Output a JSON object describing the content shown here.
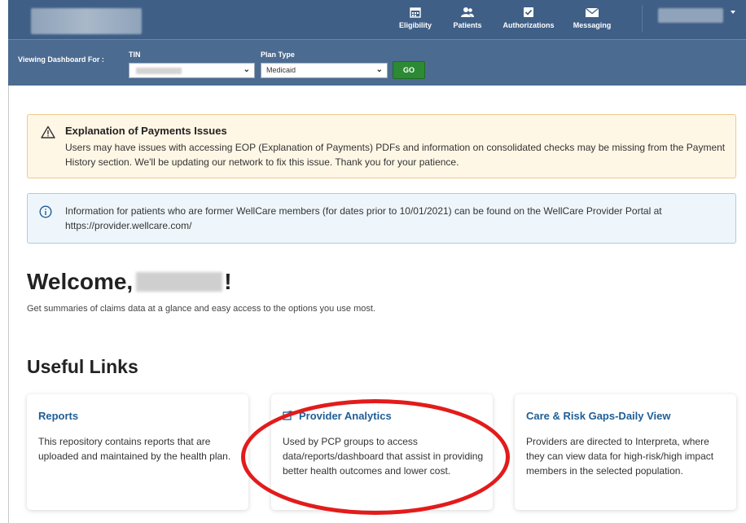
{
  "nav": {
    "items": [
      {
        "label": "Eligibility",
        "icon": "calendar-icon"
      },
      {
        "label": "Patients",
        "icon": "patients-icon"
      },
      {
        "label": "Authorizations",
        "icon": "authorizations-icon"
      },
      {
        "label": "Messaging",
        "icon": "envelope-icon"
      }
    ],
    "background": "#3f5f86"
  },
  "filter": {
    "viewing_label": "Viewing Dashboard For :",
    "tin_label": "TIN",
    "tin_value": "",
    "plan_label": "Plan Type",
    "plan_value": "Medicaid",
    "go_label": "GO",
    "go_color": "#2c8a34"
  },
  "alerts": {
    "warning": {
      "title": "Explanation of Payments Issues",
      "body": "Users may have issues with accessing EOP (Explanation of Payments) PDFs and information on consolidated checks may be missing from the Payment History section. We'll be updating our network to fix this issue.  Thank you for your patience.",
      "icon": "warning-icon"
    },
    "info": {
      "body": "Information for patients who are former WellCare members (for dates prior to 10/01/2021) can be found on the WellCare Provider Portal at https://provider.wellcare.com/",
      "icon": "info-icon"
    }
  },
  "welcome": {
    "greeting": "Welcome,",
    "suffix": "!",
    "subtitle": "Get summaries of claims data at a glance and easy access to the options you use most."
  },
  "useful_links": {
    "heading": "Useful Links",
    "cards": [
      {
        "title": "Reports",
        "body": "This repository contains reports that are uploaded and maintained by the health plan."
      },
      {
        "title": "Provider Analytics",
        "body": "Used by PCP groups to access data/reports/dashboard that assist in providing better health outcomes and lower cost.",
        "icon": "external-link-icon"
      },
      {
        "title": "Care & Risk Gaps-Daily View",
        "body": "Providers are directed to Interpreta, where they can view data for high-risk/high impact members in the selected population."
      }
    ]
  },
  "colors": {
    "link": "#1f5e96",
    "highlight": "#e31b1b"
  }
}
